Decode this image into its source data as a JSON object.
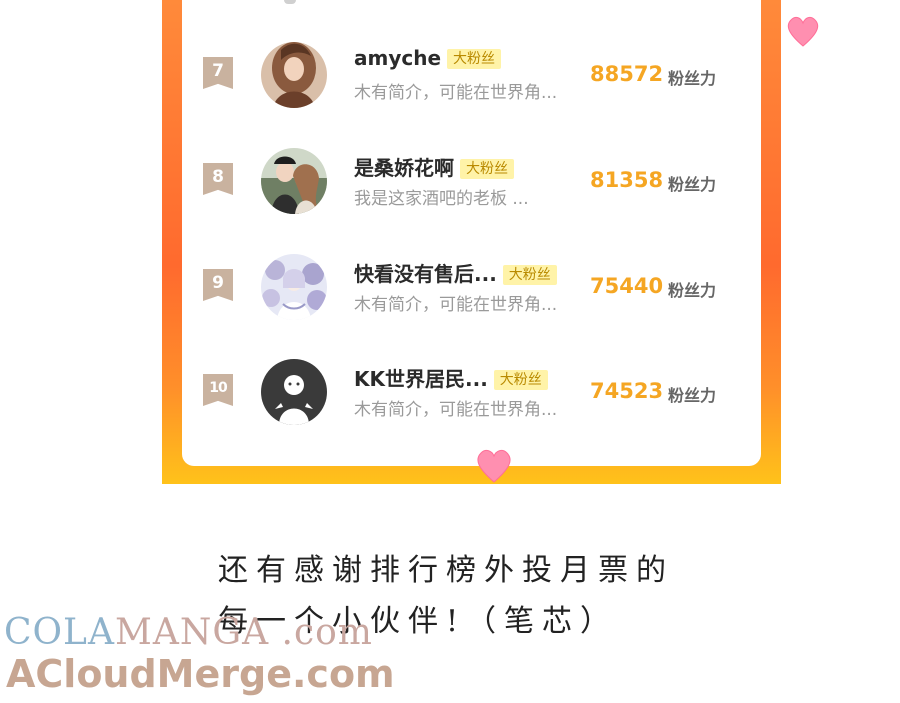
{
  "ranking": [
    {
      "rank": "7",
      "name": "amyche",
      "badge": "大粉丝",
      "bio": "木有简介，可能在世界角...",
      "score": "88572",
      "unit": "粉丝力",
      "avatar": "illustrated-girl-avatar"
    },
    {
      "rank": "8",
      "name": "是桑娇花啊",
      "badge": "大粉丝",
      "bio": "我是这家酒吧的老板  ...",
      "score": "81358",
      "unit": "粉丝力",
      "avatar": "couple-illustration-avatar"
    },
    {
      "rank": "9",
      "name": "快看没有售后...",
      "badge": "大粉丝",
      "bio": "木有简介，可能在世界角...",
      "score": "75440",
      "unit": "粉丝力",
      "avatar": "dreamy-figure-avatar"
    },
    {
      "rank": "10",
      "name": "KK世界居民...",
      "badge": "大粉丝",
      "bio": "木有简介，可能在世界角...",
      "score": "74523",
      "unit": "粉丝力",
      "avatar": "default-person-avatar"
    }
  ],
  "caption": {
    "line1": "还有感谢排行榜外投月票的",
    "line2": "每一个小伙伴!（笔芯）"
  },
  "watermark": {
    "line1_part1": "COLA",
    "line1_part2": "MANGA .com",
    "line2": "ACloudMerge.com"
  },
  "colors": {
    "frame_orange": "#ff6a2e",
    "frame_yellow": "#ffc21a",
    "score": "#f5a623",
    "badge_bg": "#fff3a8",
    "heart": "#ff7aa2"
  }
}
